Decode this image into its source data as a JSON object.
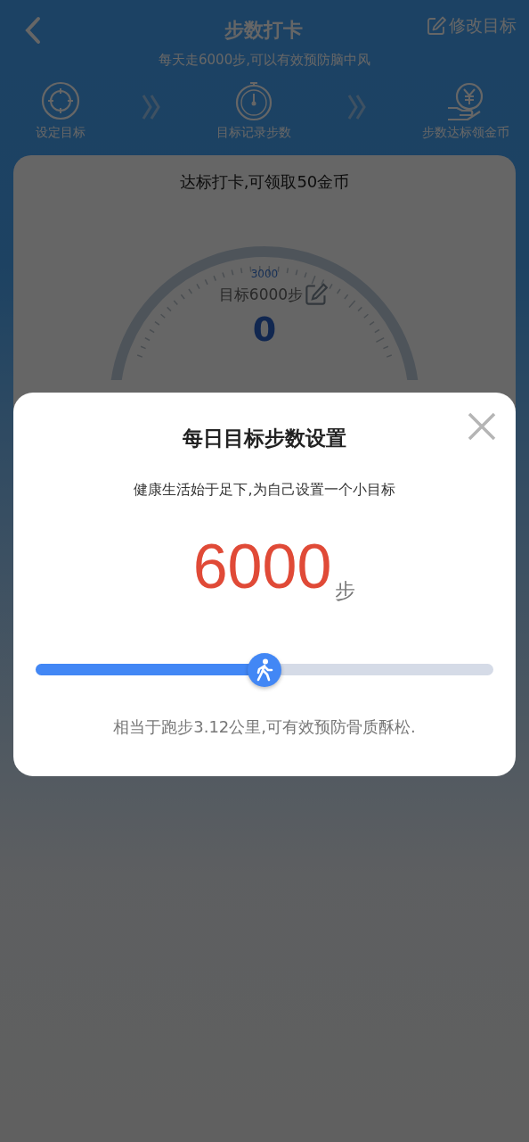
{
  "header": {
    "title": "步数打卡",
    "action": "修改目标",
    "subtitle": "每天走6000步,可以有效预防脑中风"
  },
  "steps": [
    {
      "kind": "target",
      "label": "设定目标"
    },
    {
      "kind": "stopwatch",
      "label": "目标记录步数"
    },
    {
      "kind": "coin",
      "label": "步数达标领金币"
    }
  ],
  "card": {
    "title": "达标打卡,可领取50金币",
    "gauge": {
      "scale_label": "3000",
      "goal": "目标6000步",
      "count": "0"
    }
  },
  "dialog": {
    "title": "每日目标步数设置",
    "subtitle": "健康生活始于足下,为自己设置一个小目标",
    "value": "6000",
    "unit": "步",
    "slider": {
      "level": 0.5
    },
    "note": "相当于跑步3.12公里,可有效预防骨质酥松."
  }
}
